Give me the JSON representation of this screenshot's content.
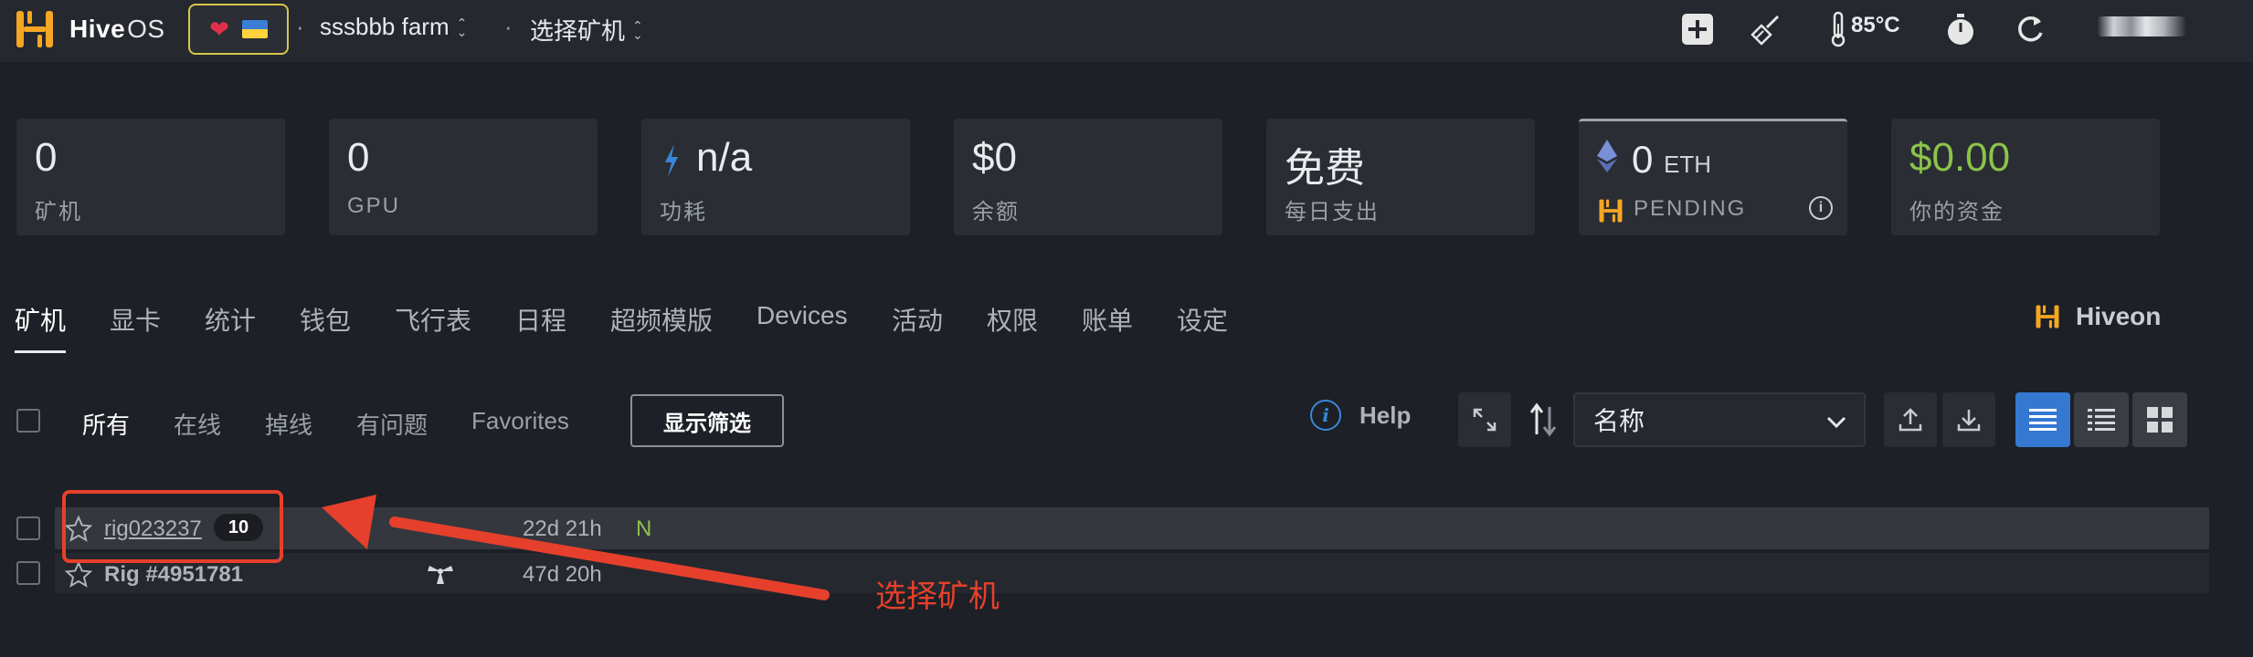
{
  "header": {
    "brand": "Hive",
    "brand_suffix": "OS",
    "breadcrumb_farm": "sssbbb farm",
    "breadcrumb_rig": "选择矿机",
    "temperature": "85°C",
    "icons": [
      "hive-logo-icon",
      "heart-icon",
      "ukraine-flag-icon",
      "plus-icon",
      "broom-icon",
      "thermometer-icon",
      "stopwatch-icon",
      "refresh-icon"
    ]
  },
  "stats": {
    "rigs": {
      "value": "0",
      "label": "矿机"
    },
    "gpu": {
      "value": "0",
      "label": "GPU"
    },
    "power": {
      "value": "n/a",
      "label": "功耗"
    },
    "balance": {
      "value": "$0",
      "label": "余额"
    },
    "daily": {
      "value": "免费",
      "label": "每日支出"
    },
    "eth": {
      "value": "0",
      "unit": "ETH",
      "label": "PENDING"
    },
    "funds": {
      "value": "$0.00",
      "label": "你的资金"
    }
  },
  "tabs": [
    "矿机",
    "显卡",
    "统计",
    "钱包",
    "飞行表",
    "日程",
    "超频模版",
    "Devices",
    "活动",
    "权限",
    "账单",
    "设定"
  ],
  "hiveon_label": "Hiveon",
  "filters": {
    "items": [
      "所有",
      "在线",
      "掉线",
      "有问题",
      "Favorites"
    ],
    "show_filter_button": "显示筛选",
    "help": "Help",
    "sort_select": "名称"
  },
  "rigs": [
    {
      "name": "rig023237",
      "badge": "10",
      "uptime": "22d 21h",
      "status": "N"
    },
    {
      "name": "Rig #4951781",
      "uptime": "47d 20h"
    }
  ],
  "annotation": "选择矿机",
  "colors": {
    "accent_blue": "#3478d1",
    "green": "#8cc34a",
    "annotation_red": "#e6402c",
    "hive_orange": "#f5a623"
  }
}
